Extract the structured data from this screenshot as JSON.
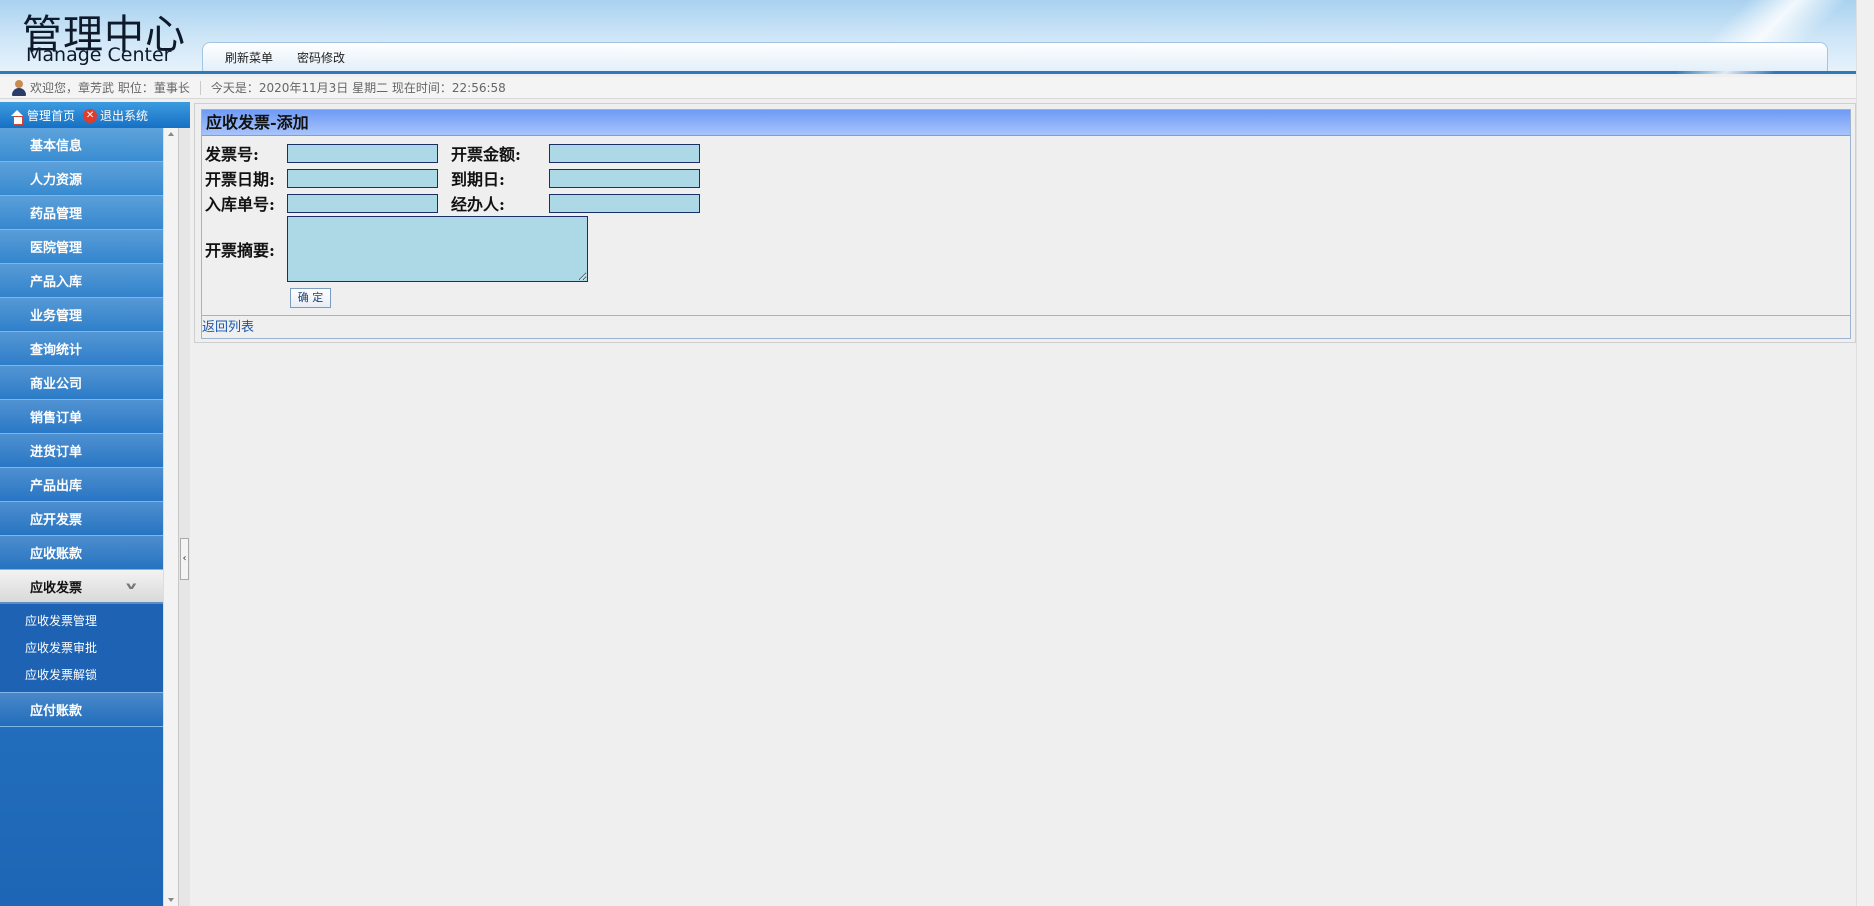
{
  "header": {
    "logo_cn": "管理中心",
    "logo_en": "Manage Center",
    "nav": [
      "刷新菜单",
      "密码修改"
    ]
  },
  "status": {
    "welcome": "欢迎您，章芳武  职位：董事长",
    "datetime": "今天是：2020年11月3日 星期二 现在时间：22:56:58"
  },
  "sidebar": {
    "home": "管理首页",
    "exit": "退出系统",
    "items": [
      "基本信息",
      "人力资源",
      "药品管理",
      "医院管理",
      "产品入库",
      "业务管理",
      "查询统计",
      "商业公司",
      "销售订单",
      "进货订单",
      "产品出库",
      "应开发票",
      "应收账款"
    ],
    "active": "应收发票",
    "subitems": [
      "应收发票管理",
      "应收发票审批",
      "应收发票解锁"
    ],
    "after": "应付账款"
  },
  "form": {
    "title": "应收发票-添加",
    "invoice_no_label": "发票号:",
    "amount_label": "开票金额:",
    "date_label": "开票日期:",
    "due_label": "到期日:",
    "stock_no_label": "入库单号:",
    "handler_label": "经办人:",
    "memo_label": "开票摘要:",
    "invoice_no": "",
    "amount": "",
    "date": "",
    "due": "",
    "stock_no": "",
    "handler": "",
    "memo": "",
    "submit": "确 定",
    "back": "返回列表"
  },
  "colors": {
    "header_bar": "#2f78b9",
    "sidebar_blue": "#2978c6",
    "input_bg": "#add8e6",
    "title_bar": "#6f9bf5"
  }
}
